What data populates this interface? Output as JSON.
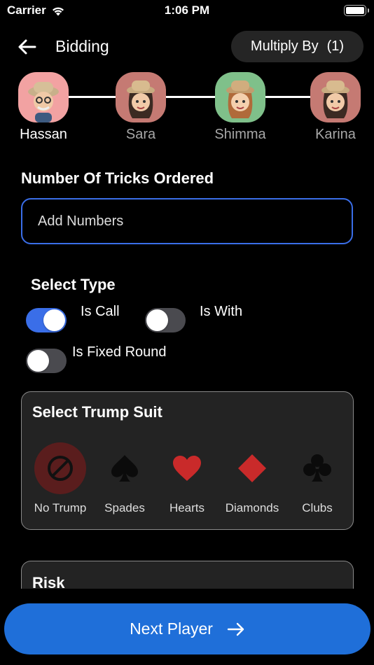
{
  "status_bar": {
    "carrier": "Carrier",
    "time": "1:06 PM"
  },
  "header": {
    "title": "Bidding",
    "multiply_label": "Multiply By",
    "multiply_value": "(1)"
  },
  "players": [
    {
      "name": "Hassan",
      "active": true,
      "bg": "#f2a2a2"
    },
    {
      "name": "Sara",
      "active": false,
      "bg": "#c57a73"
    },
    {
      "name": "Shimma",
      "active": false,
      "bg": "#7fc08a"
    },
    {
      "name": "Karina",
      "active": false,
      "bg": "#c57a73"
    }
  ],
  "tricks": {
    "label": "Number Of Tricks Ordered",
    "placeholder": "Add Numbers",
    "value": ""
  },
  "select_type": {
    "label": "Select Type",
    "options": [
      {
        "label": "Is Call",
        "on": true
      },
      {
        "label": "Is With",
        "on": false
      },
      {
        "label": "Is Fixed Round",
        "on": false
      }
    ]
  },
  "trump": {
    "title": "Select Trump Suit",
    "suits": [
      {
        "label": "No Trump",
        "icon": "no-trump-icon",
        "selected": true
      },
      {
        "label": "Spades",
        "icon": "spade-icon",
        "selected": false
      },
      {
        "label": "Hearts",
        "icon": "heart-icon",
        "selected": false
      },
      {
        "label": "Diamonds",
        "icon": "diamond-icon",
        "selected": false
      },
      {
        "label": "Clubs",
        "icon": "club-icon",
        "selected": false
      }
    ]
  },
  "risk": {
    "title": "Risk"
  },
  "next_button": {
    "label": "Next Player"
  },
  "colors": {
    "accent": "#3a6ee8",
    "button": "#1f6fd9",
    "red_suit": "#c92a2a",
    "selected_suit_bg": "#5a1d1d"
  }
}
